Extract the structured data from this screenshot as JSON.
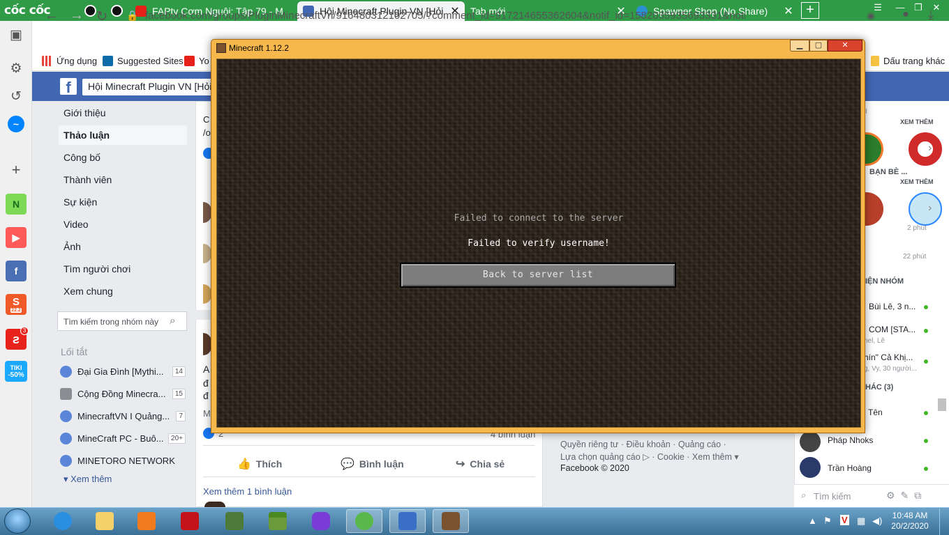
{
  "browser": {
    "logo": "cốc cốc",
    "tabs": [
      {
        "title": "FAPtv Cơm Nguội: Tập 79 - M",
        "color": "#e62117"
      },
      {
        "title": "Hội Minecraft Plugin VN [Hỏi",
        "color": "#4267b2"
      },
      {
        "title": "Tab mới",
        "color": ""
      },
      {
        "title": "Spawner Shop (No Share)",
        "color": "#2b8fd6"
      }
    ],
    "new_tab": "+",
    "url": "facebook.com/groups/PluginMinecraftVn/916480312102705/?comment_id=917214655362604&notif_id=1582035935693331&notif_t=group_c",
    "bookmarks": [
      {
        "label": "Ứng dụng"
      },
      {
        "label": "Suggested Sites"
      },
      {
        "label": "Yo"
      }
    ],
    "other_bookmarks": "Dấu trang khác"
  },
  "sidebar_apps": {
    "shopee_badge": "22.2",
    "ali_badge": "3",
    "tiki_label": "TIKI",
    "tiki_discount": "-50%"
  },
  "facebook": {
    "search_value": "Hội Minecraft Plugin VN [Hỏi",
    "nav": [
      {
        "label": "Giới thiệu"
      },
      {
        "label": "Thảo luận"
      },
      {
        "label": "Công bố"
      },
      {
        "label": "Thành viên"
      },
      {
        "label": "Sự kiện"
      },
      {
        "label": "Video"
      },
      {
        "label": "Ảnh"
      },
      {
        "label": "Tìm người chơi"
      },
      {
        "label": "Xem chung"
      }
    ],
    "group_search_placeholder": "Tìm kiếm trong nhóm này",
    "shortcuts_title": "Lối tắt",
    "shortcuts": [
      {
        "label": "Đại Gia Đình [Mythi...",
        "count": "14"
      },
      {
        "label": "Cộng Đồng Minecra...",
        "count": "15"
      },
      {
        "label": "MinecraftVN I Quảng...",
        "count": "7"
      },
      {
        "label": "MineCraft PC - Buô...",
        "count": "20+"
      },
      {
        "label": "MINETORO NETWORK",
        "count": ""
      }
    ],
    "see_more": "Xem thêm",
    "feed": {
      "frag_c": "C",
      "frag_o": "/o",
      "frag_a": "A",
      "frag_d1": "đ",
      "frag_d2": "đ",
      "frag_m": "M",
      "like_count": "2",
      "comment_count": "4 bình luận",
      "actions": {
        "like": "Thích",
        "comment": "Bình luận",
        "share": "Chia sẻ"
      },
      "see_more_comments": "Xem thêm 1 bình luận"
    },
    "footer": {
      "line1": "Quyền riêng tư · Điều khoản · Quảng cáo ·",
      "line2": "Lựa chọn quảng cáo ▷ · Cookie · Xem thêm ▾",
      "line3": "Facebook © 2020"
    },
    "right": {
      "frag_i": "I",
      "see_more_1": "XEM THÊM",
      "friends_label": "BẠN BÈ ...",
      "see_more_2": "XEM THÊM",
      "time_1": "2 phút",
      "time_2": "22 phút",
      "group_header": "IỆN NHÓM",
      "g1": "Bùi Lê, 3 n...",
      "g2": "COM [STA...",
      "g2_sub": "nel, Lê",
      "g3": "hín\" Cả Khị...",
      "g3_sub": "g, Vy, 30 người...",
      "other_header": "HÁC (3)",
      "c1": "Tên",
      "c2": "Pháp Nhoks",
      "c3": "Trần Hoàng",
      "search": "Tìm kiếm"
    }
  },
  "minecraft": {
    "title": "Minecraft 1.12.2",
    "line1": "Failed to connect to the server",
    "line2": "Failed to verify username!",
    "button": "Back to server list"
  },
  "taskbar": {
    "time": "10:48 AM",
    "date": "20/2/2020"
  }
}
